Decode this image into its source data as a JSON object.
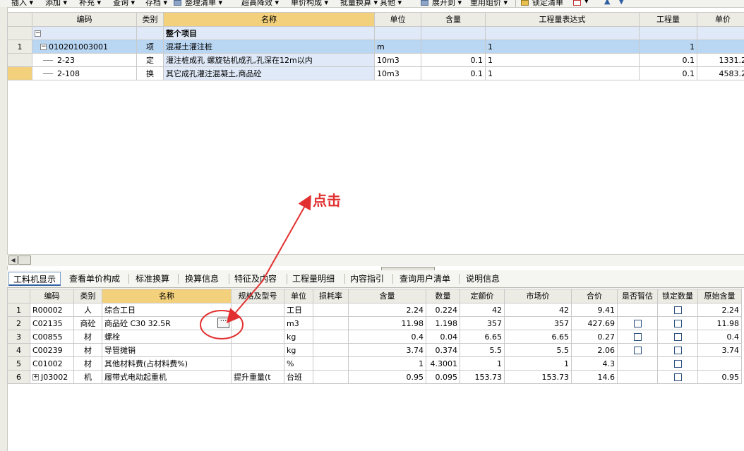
{
  "toolbar": [
    "插入 ▾",
    "添加 ▾",
    "补充 ▾",
    "查询 ▾",
    "存档 ▾",
    "整理清单 ▾",
    "超高降效 ▾",
    "单价构成 ▾",
    "批量换算 ▾",
    "其他 ▾",
    "展开到 ▾",
    "重用组价 ▾",
    "锁定清单",
    "▾"
  ],
  "upper": {
    "headers": [
      "",
      "编码",
      "类别",
      "名称",
      "单位",
      "含量",
      "工程量表达式",
      "工程量",
      "单价"
    ],
    "rows": [
      {
        "rn": "",
        "code": "",
        "type": "",
        "name": "整个项目",
        "unit": "",
        "qty": "",
        "expr": "",
        "amount": "",
        "price": ""
      },
      {
        "rn": "1",
        "code": "010201003001",
        "type": "项",
        "name": "混凝土灌注桩",
        "unit": "m",
        "qty": "",
        "expr": "1",
        "amount": "1",
        "price": ""
      },
      {
        "rn": "",
        "code": "2-23",
        "type": "定",
        "name": "灌注桩成孔 螺旋钻机成孔,孔深在12m以内",
        "unit": "10m3",
        "qty": "0.1",
        "expr": "1",
        "amount": "0.1",
        "price": "1331.2"
      },
      {
        "rn": "",
        "code": "2-108",
        "type": "换",
        "name": "其它成孔灌注混凝土,商品砼",
        "unit": "10m3",
        "qty": "0.1",
        "expr": "1",
        "amount": "0.1",
        "price": "4583.2"
      }
    ]
  },
  "annotation": {
    "text": "点击"
  },
  "tabs": [
    "工料机显示",
    "查看单价构成",
    "标准换算",
    "换算信息",
    "特征及内容",
    "工程量明细",
    "内容指引",
    "查询用户清单",
    "说明信息"
  ],
  "lower": {
    "headers": [
      "",
      "编码",
      "类别",
      "名称",
      "规格及型号",
      "单位",
      "损耗率",
      "含量",
      "数量",
      "定额价",
      "市场价",
      "合价",
      "是否暂估",
      "锁定数量",
      "原始含量"
    ],
    "rows": [
      {
        "rn": "1",
        "code": "R00002",
        "type": "人",
        "name": "综合工日",
        "spec": "",
        "unit": "工日",
        "loss": "",
        "content": "2.24",
        "count": "0.224",
        "base": "42",
        "market": "42",
        "total": "9.41",
        "est": false,
        "lock": true,
        "orig": "2.24"
      },
      {
        "rn": "2",
        "code": "C02135",
        "type": "商砼",
        "name": "商品砼 C30 32.5R",
        "spec": "",
        "unit": "m3",
        "loss": "",
        "content": "11.98",
        "count": "1.198",
        "base": "357",
        "market": "357",
        "total": "427.69",
        "est": true,
        "lock": true,
        "orig": "11.98"
      },
      {
        "rn": "3",
        "code": "C00855",
        "type": "材",
        "name": "螺栓",
        "spec": "",
        "unit": "kg",
        "loss": "",
        "content": "0.4",
        "count": "0.04",
        "base": "6.65",
        "market": "6.65",
        "total": "0.27",
        "est": true,
        "lock": true,
        "orig": "0.4"
      },
      {
        "rn": "4",
        "code": "C00239",
        "type": "材",
        "name": "导管摊销",
        "spec": "",
        "unit": "kg",
        "loss": "",
        "content": "3.74",
        "count": "0.374",
        "base": "5.5",
        "market": "5.5",
        "total": "2.06",
        "est": true,
        "lock": true,
        "orig": "3.74"
      },
      {
        "rn": "5",
        "code": "C01002",
        "type": "材",
        "name": "其他材料费(占材料费%)",
        "spec": "",
        "unit": "%",
        "loss": "",
        "content": "1",
        "count": "4.3001",
        "base": "1",
        "market": "1",
        "total": "4.3",
        "est": false,
        "lock": true,
        "orig": ""
      },
      {
        "rn": "6",
        "code": "J03002",
        "type": "机",
        "name": "履带式电动起重机",
        "spec": "提升重量(t",
        "unit": "台班",
        "loss": "",
        "content": "0.95",
        "count": "0.095",
        "base": "153.73",
        "market": "153.73",
        "total": "14.6",
        "est": false,
        "lock": true,
        "orig": "0.95"
      }
    ]
  },
  "colors": {
    "header_bg": "#ecebe4",
    "name_header": "#f2d07c",
    "selected_row": "#b9d6f2",
    "annotation": "#e23030"
  }
}
